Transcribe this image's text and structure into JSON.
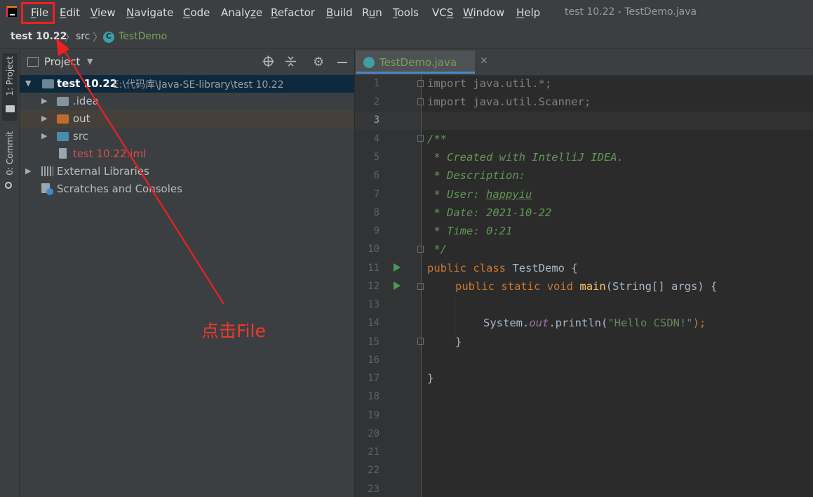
{
  "menu": {
    "items": [
      {
        "u": "F",
        "rest": "ile"
      },
      {
        "u": "E",
        "rest": "dit"
      },
      {
        "u": "V",
        "rest": "iew"
      },
      {
        "u": "N",
        "rest": "avigate"
      },
      {
        "u": "C",
        "rest": "ode"
      },
      {
        "pre": "Analy",
        "u": "z",
        "rest": "e"
      },
      {
        "u": "R",
        "rest": "efactor"
      },
      {
        "u": "B",
        "rest": "uild"
      },
      {
        "pre": "R",
        "u": "u",
        "rest": "n"
      },
      {
        "u": "T",
        "rest": "ools"
      },
      {
        "pre": "VC",
        "u": "S",
        "rest": ""
      },
      {
        "u": "W",
        "rest": "indow"
      },
      {
        "u": "H",
        "rest": "elp"
      }
    ],
    "window_title": "test 10.22 - TestDemo.java"
  },
  "breadcrumb": {
    "project": "test 10.22",
    "folder": "src",
    "file": "TestDemo"
  },
  "toolstrip": {
    "project_label": "1: Project",
    "commit_label": "0: Commit"
  },
  "project_panel": {
    "title": "Project",
    "tree": {
      "root_name": "test 10.22",
      "root_path": "E:\\代码库\\Java-SE-library\\test 10.22",
      "items": [
        ".idea",
        "out",
        "src",
        "test 10.22.iml"
      ],
      "external_libraries": "External Libraries",
      "scratches": "Scratches and Consoles"
    }
  },
  "editor": {
    "tab_label": "TestDemo.java",
    "line_numbers": [
      "1",
      "2",
      "3",
      "4",
      "5",
      "6",
      "7",
      "8",
      "9",
      "10",
      "11",
      "12",
      "13",
      "14",
      "15",
      "16",
      "17",
      "18",
      "19",
      "20",
      "21",
      "22",
      "23"
    ],
    "code": {
      "import1": "import java.util.*;",
      "import2": "import java.util.Scanner;",
      "doc_open": "/**",
      "doc_created": " * Created with IntelliJ IDEA.",
      "doc_desc": " * Description:",
      "doc_user_prefix": " * User: ",
      "doc_user": "happyiu",
      "doc_date": " * Date: 2021-10-22",
      "doc_time": " * Time: 0:21",
      "doc_close": " */",
      "kw_public": "public",
      "kw_class": "class",
      "class_name": "TestDemo",
      "brace_open": "{",
      "kw_static": "static",
      "kw_void": "void",
      "method_name": "main",
      "params": "(String[] args)",
      "println_obj": "System.",
      "println_field": "out",
      "println_call": ".println(",
      "string_literal": "\"Hello CSDN!\"",
      "println_end": ");",
      "brace_close": "}"
    }
  },
  "annotation": {
    "text": "点击File",
    "color": "#ea3a2c"
  }
}
